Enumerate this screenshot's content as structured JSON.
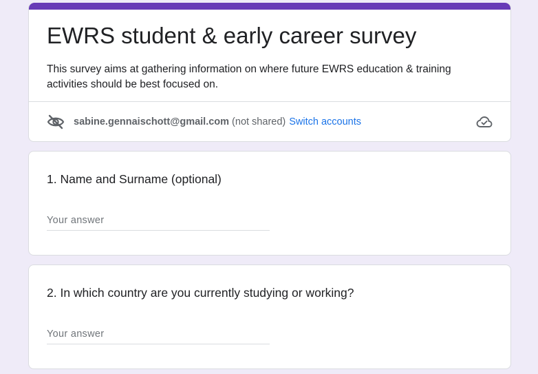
{
  "form": {
    "title": "EWRS student & early career survey",
    "description": "This survey aims at gathering information on where future EWRS education & training activities should be best focused on.",
    "accent_color": "#673ab7",
    "background_color": "#efebf8"
  },
  "account": {
    "email": "sabine.gennaischott@gmail.com",
    "visibility_note": "(not shared)",
    "switch_label": "Switch accounts",
    "privacy_icon": "eye-off-icon",
    "save_status_icon": "cloud-check-icon"
  },
  "questions": [
    {
      "title": "1. Name and Surname (optional)",
      "placeholder": "Your answer",
      "value": ""
    },
    {
      "title": "2. In which country are you currently studying or working?",
      "placeholder": "Your answer",
      "value": ""
    }
  ]
}
